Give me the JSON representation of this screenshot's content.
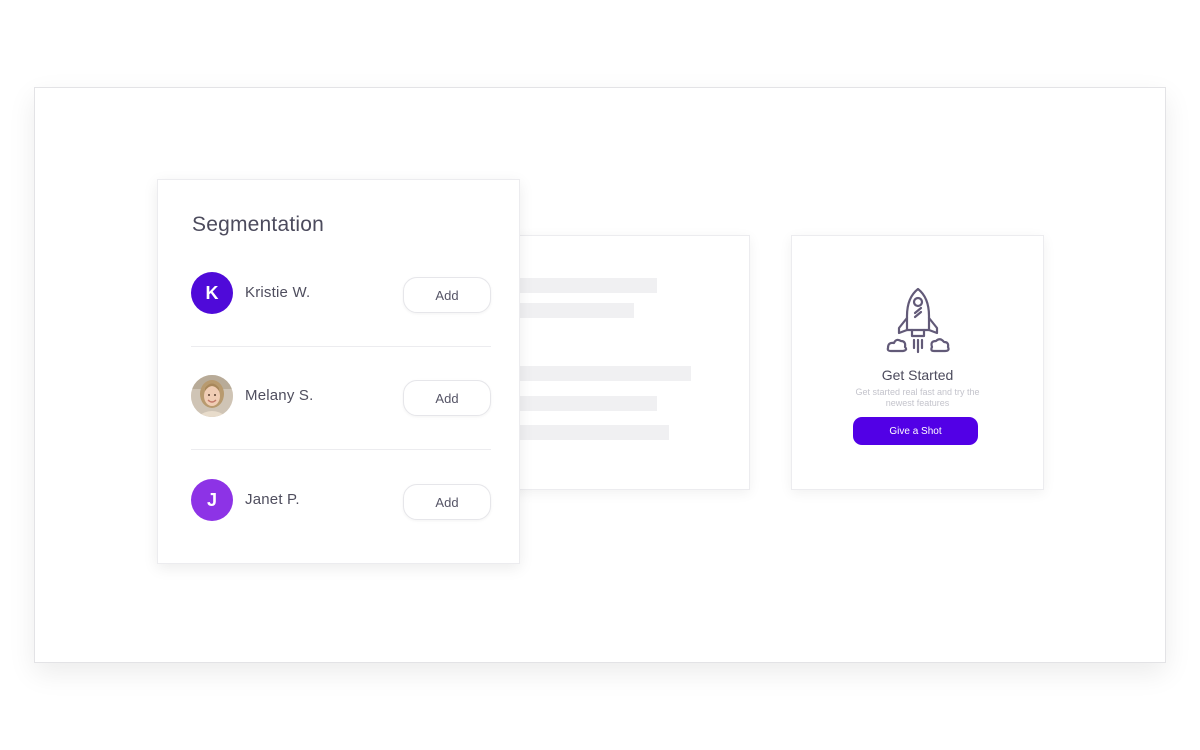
{
  "segmentation": {
    "title": "Segmentation",
    "users": [
      {
        "initial": "K",
        "name": "Kristie W.",
        "avatar_color": "#4f0ad9",
        "avatar_type": "letter",
        "add_label": "Add"
      },
      {
        "initial": "",
        "name": "Melany S.",
        "avatar_color": "#b9a893",
        "avatar_type": "photo",
        "add_label": "Add"
      },
      {
        "initial": "J",
        "name": "Janet P.",
        "avatar_color": "#8d33e6",
        "avatar_type": "letter",
        "add_label": "Add"
      }
    ]
  },
  "get_started": {
    "icon": "rocket-icon",
    "title": "Get Started",
    "subtitle": "Get started real fast and try the newest features",
    "button_label": "Give a Shot",
    "accent": "#5200e6"
  }
}
